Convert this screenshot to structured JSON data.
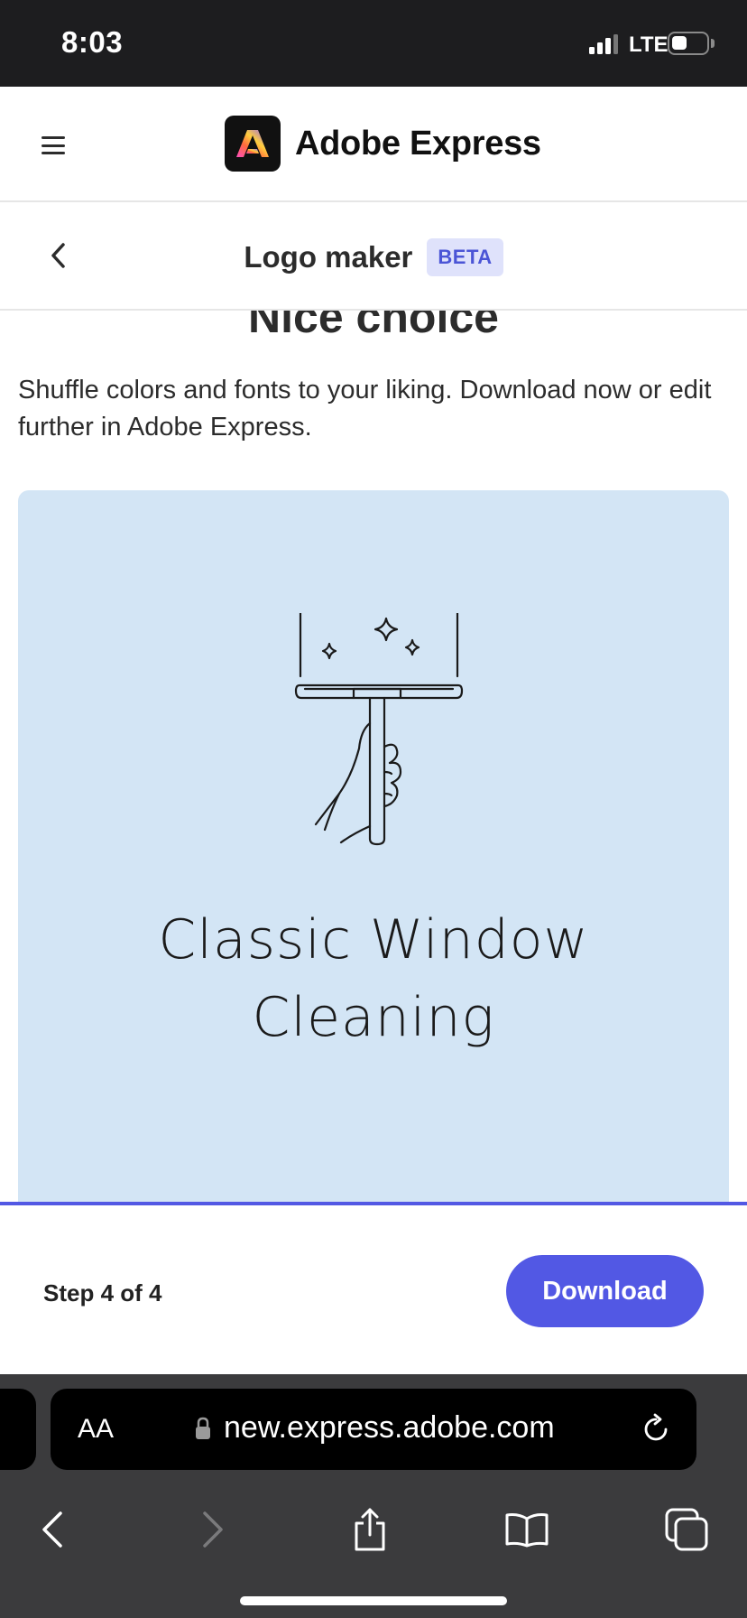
{
  "status_bar": {
    "time": "8:03",
    "network": "LTE"
  },
  "app_header": {
    "brand_name": "Adobe Express"
  },
  "sub_header": {
    "title": "Logo maker",
    "badge": "BETA"
  },
  "content": {
    "heading": "Nice choice",
    "description": "Shuffle colors and fonts to your liking. Download now or edit further in Adobe Express.",
    "logo_preview": {
      "line1": "Classic Window",
      "line2": "Cleaning",
      "background_color": "#d3e5f5",
      "icon": "window-squeegee-icon"
    }
  },
  "footer": {
    "step_label": "Step 4 of 4",
    "download_label": "Download"
  },
  "browser": {
    "text_size_label": "AA",
    "url": "new.express.adobe.com"
  },
  "colors": {
    "accent": "#5258e4",
    "beta_bg": "#dfe2fb",
    "beta_text": "#4b55d6"
  }
}
